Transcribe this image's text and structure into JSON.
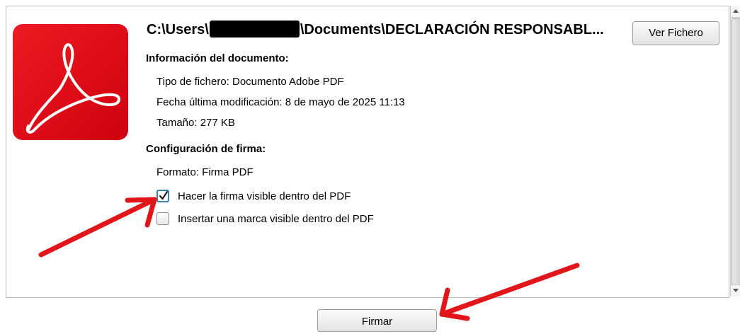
{
  "document": {
    "path_prefix": "C:\\Users\\",
    "path_suffix": "\\Documents\\DECLARACIÓN RESPONSABL...",
    "view_button_label": "Ver Fichero"
  },
  "info": {
    "heading": "Información del documento:",
    "file_type": "Tipo de fichero: Documento Adobe PDF",
    "modified": "Fecha última modificación: 8 de mayo de 2025 11:13",
    "size": "Tamaño: 277 KB"
  },
  "signature": {
    "heading": "Configuración de firma:",
    "format": "Formato: Firma PDF",
    "visible_signature": {
      "label": "Hacer la firma visible dentro del PDF",
      "checked": true
    },
    "visible_mark": {
      "label": "Insertar una marca visible dentro del PDF",
      "checked": false
    }
  },
  "footer": {
    "sign_button_label": "Firmar"
  },
  "colors": {
    "pdf_red": "#e3001b",
    "annotation_arrow": "#e0161b",
    "checkbox_focus": "#3c7fb1"
  },
  "icons": {
    "document": "adobe-pdf-icon"
  }
}
